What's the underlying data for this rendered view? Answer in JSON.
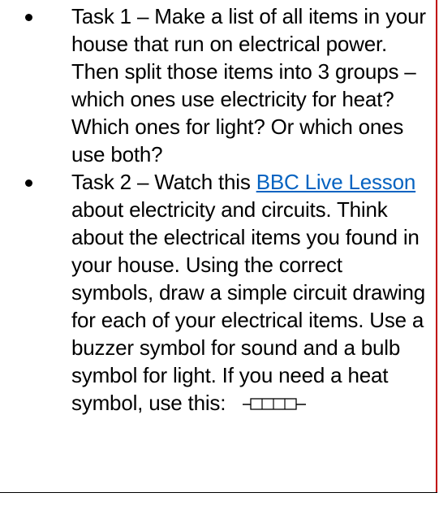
{
  "tasks": [
    {
      "text": "Task 1 – Make a list of all items in your house that run on electrical power. Then split those items into 3 groups – which ones use electricity for heat? Which ones for light? Or which ones use both?"
    },
    {
      "before_link": "Task 2 – Watch this ",
      "link_text": "BBC Live Lesson",
      "after_link": " about electricity and circuits. Think about the electrical items you found in your house. Using the correct symbols, draw a simple circuit drawing for each of your electrical items. Use a buzzer symbol for sound and a bulb symbol for light. If you need a heat symbol, use this:",
      "symbol_icon": "heater-resistor-symbol-icon"
    }
  ],
  "colors": {
    "link": "#0563c1",
    "border": "#c00000",
    "text": "#000000"
  }
}
